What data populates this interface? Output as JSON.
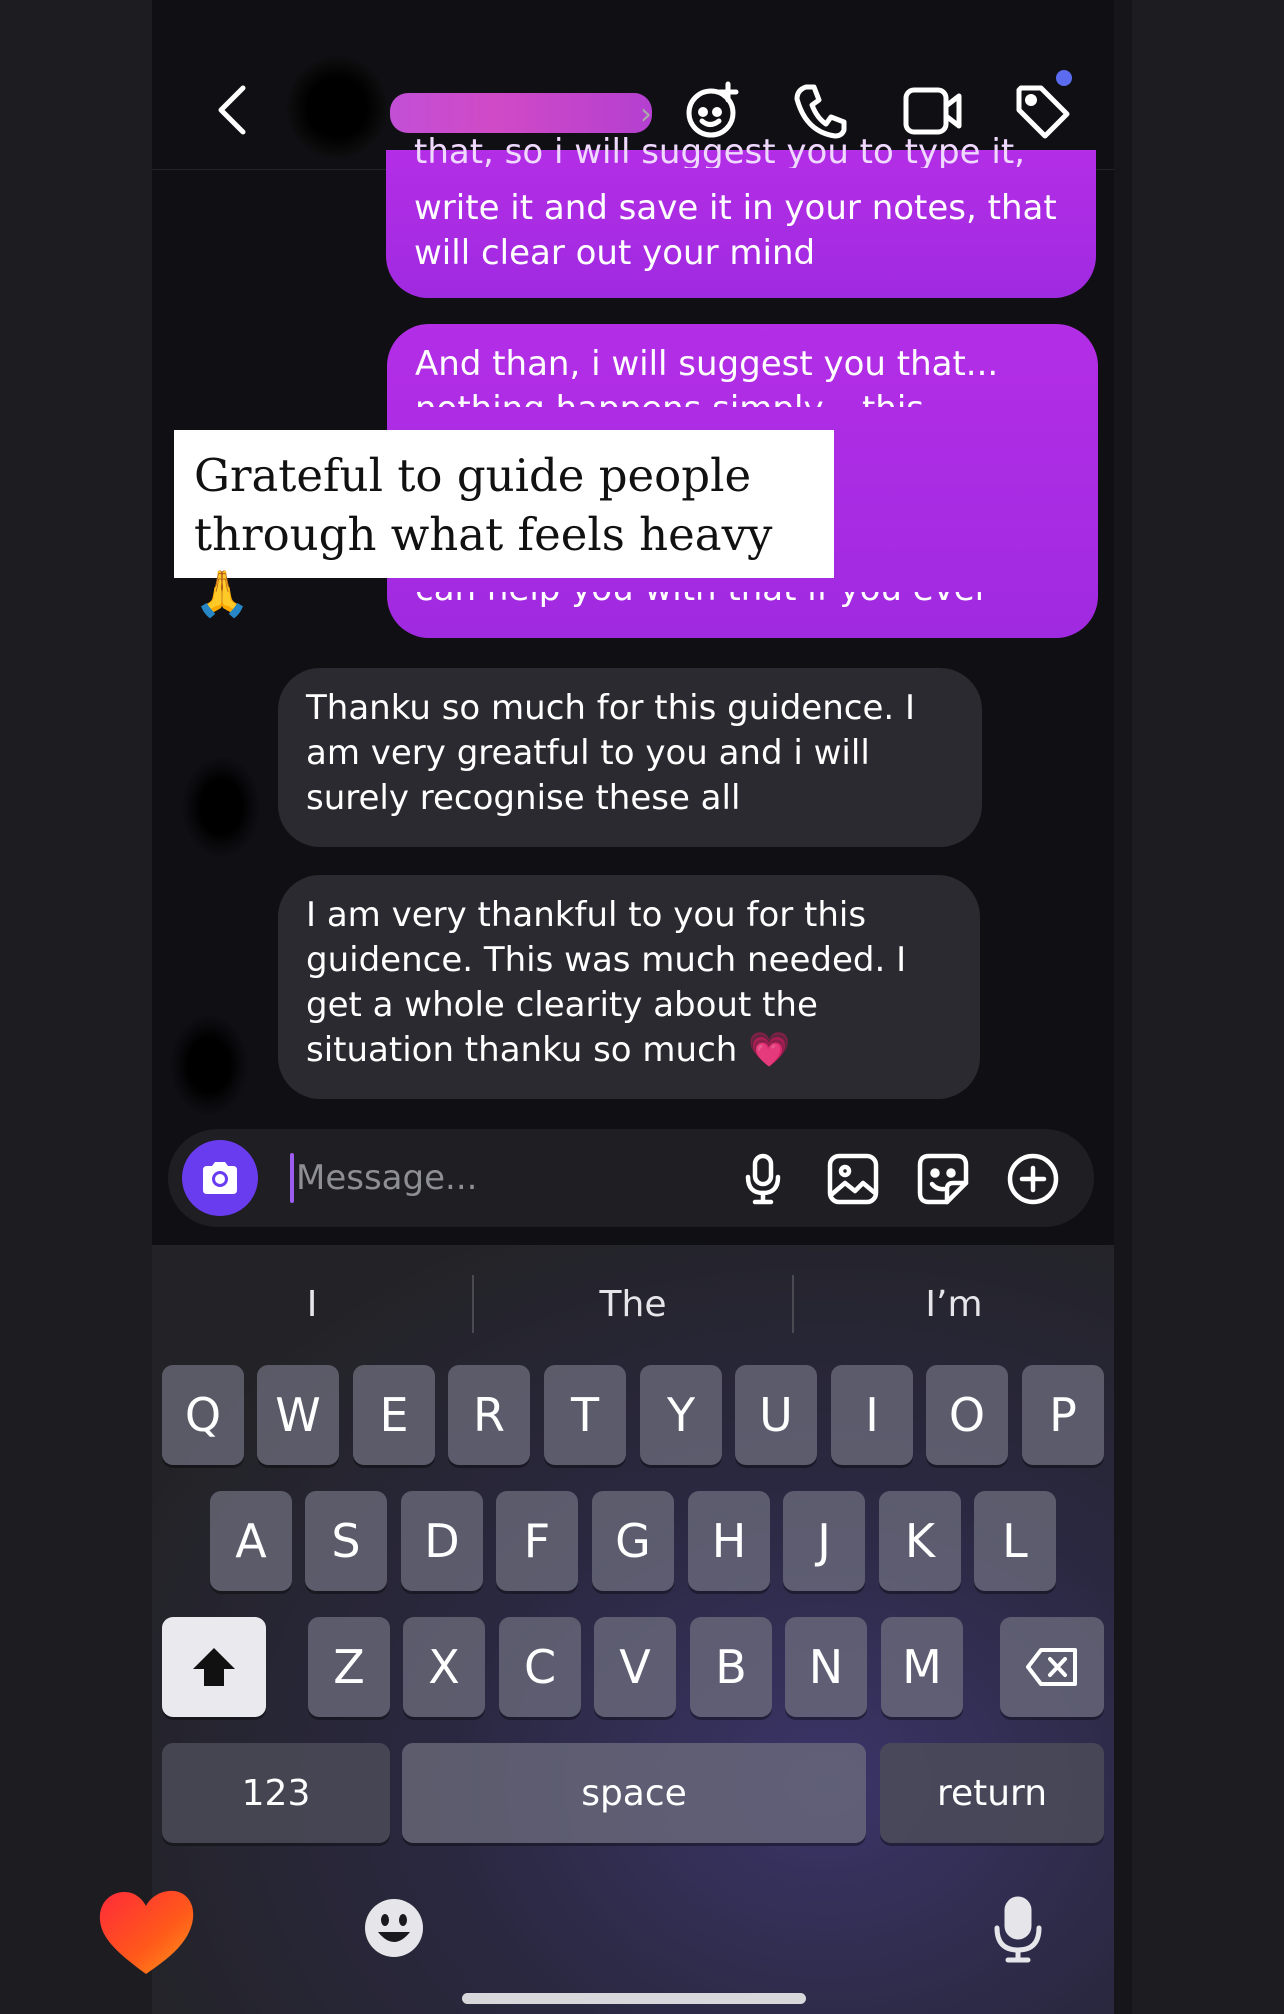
{
  "header": {
    "back_icon": "chevron-left-icon",
    "actions": [
      "sparkle-face-icon",
      "phone-icon",
      "video-icon",
      "tag-icon"
    ]
  },
  "messages": {
    "sent_1_partial": "that, so i will suggest you to type it,",
    "sent_1_text": "write it and save it in your notes, that will clear out your mind",
    "sent_2_line1": "And than, i will suggest you that...",
    "sent_2_line2": "nothing happens simply... this incident",
    "sent_2_last": "can help you with that if you ever need",
    "recv_1": "Thanku so much for this guidence. I am very greatful to you and i will surely recognise these all",
    "recv_2": "I am very thankful to you for this guidence. This was much needed. I get a whole clearity about the situation thanku so much 💗"
  },
  "overlay": {
    "caption": "Grateful to guide people through what feels heavy 🙏"
  },
  "composer": {
    "placeholder": "Message..."
  },
  "keyboard": {
    "suggestions": [
      "I",
      "The",
      "I’m"
    ],
    "row1": [
      "Q",
      "W",
      "E",
      "R",
      "T",
      "Y",
      "U",
      "I",
      "O",
      "P"
    ],
    "row2": [
      "A",
      "S",
      "D",
      "F",
      "G",
      "H",
      "J",
      "K",
      "L"
    ],
    "row3": [
      "Z",
      "X",
      "C",
      "V",
      "B",
      "N",
      "M"
    ],
    "numbers_label": "123",
    "space_label": "space",
    "return_label": "return"
  },
  "bottom": {
    "heart": "❤️",
    "emoji": "😀"
  },
  "colors": {
    "sent_bubble": "#b32ee6",
    "received_bubble": "#2a2a30",
    "accent": "#6a3cf0",
    "notification_dot": "#5b6cf0"
  }
}
